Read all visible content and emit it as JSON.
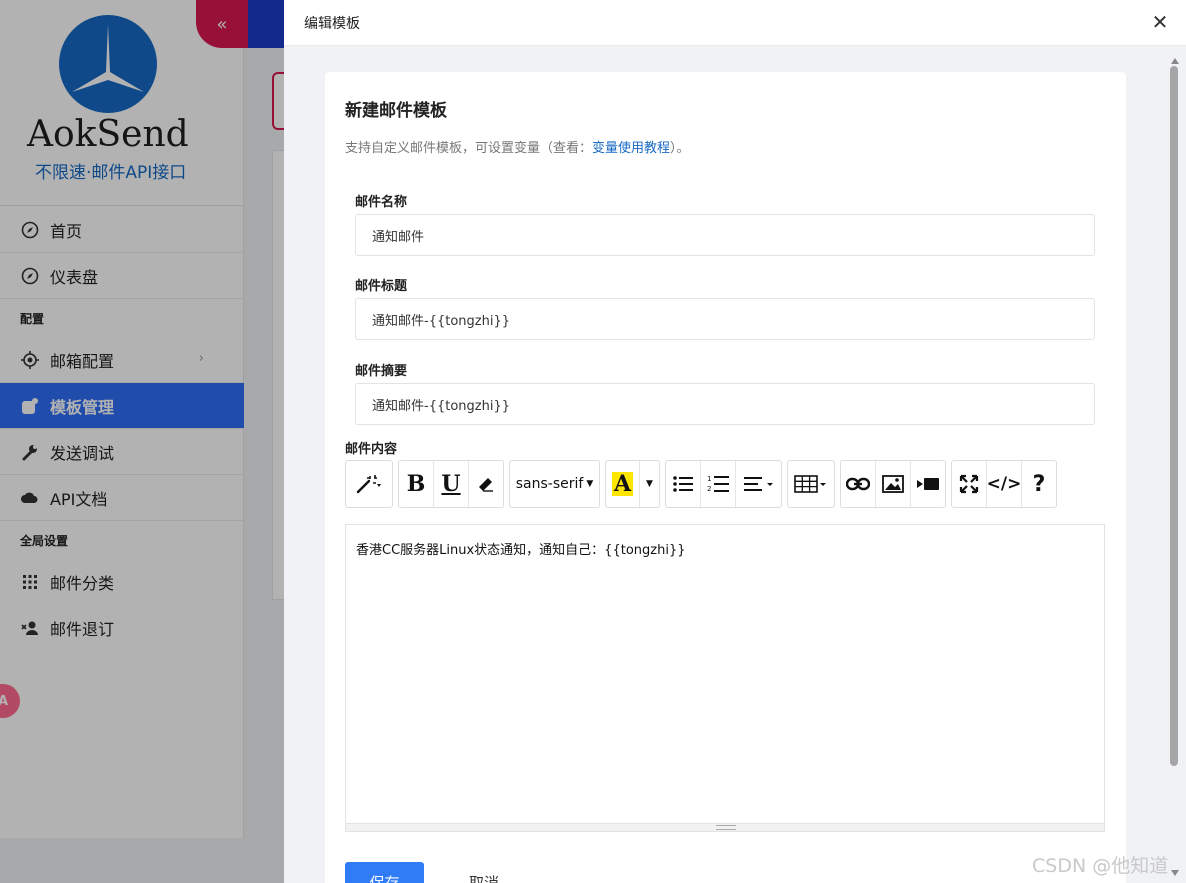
{
  "sidebar": {
    "logo_text": "AokSend",
    "logo_sub": "不限速·邮件API接口",
    "items": [
      {
        "label": "首页",
        "icon": "compass-icon"
      },
      {
        "label": "仪表盘",
        "icon": "compass-icon"
      }
    ],
    "section_config": "配置",
    "config_items": [
      {
        "label": "邮箱配置",
        "icon": "target-icon"
      },
      {
        "label": "模板管理",
        "icon": "template-icon"
      },
      {
        "label": "发送调试",
        "icon": "wrench-icon"
      },
      {
        "label": "API文档",
        "icon": "cloud-icon"
      }
    ],
    "section_global": "全局设置",
    "global_items": [
      {
        "label": "邮件分类",
        "icon": "grid-icon"
      },
      {
        "label": "邮件退订",
        "icon": "user-remove-icon"
      }
    ],
    "float_badge": "A"
  },
  "drawer": {
    "title": "编辑模板",
    "form_title": "新建邮件模板",
    "desc_prefix": "支持自定义邮件模板，可设置变量（查看：",
    "desc_link": "变量使用教程",
    "desc_suffix": "）。",
    "fields": {
      "name_label": "邮件名称",
      "name_value": "通知邮件",
      "subject_label": "邮件标题",
      "subject_value": "通知邮件-{{tongzhi}}",
      "summary_label": "邮件摘要",
      "summary_value": "通知邮件-{{tongzhi}}"
    },
    "content_label": "邮件内容",
    "font_select": "sans-serif",
    "editor_content": "香港CC服务器Linux状态通知，通知自己：{{tongzhi}}",
    "save_button": "保存",
    "cancel_button": "取消"
  },
  "colors": {
    "accent": "#2f6df5",
    "brand_red": "#d91850",
    "topbar": "#1d3bc9",
    "link": "#1769c4"
  },
  "watermark": "CSDN @他知道"
}
